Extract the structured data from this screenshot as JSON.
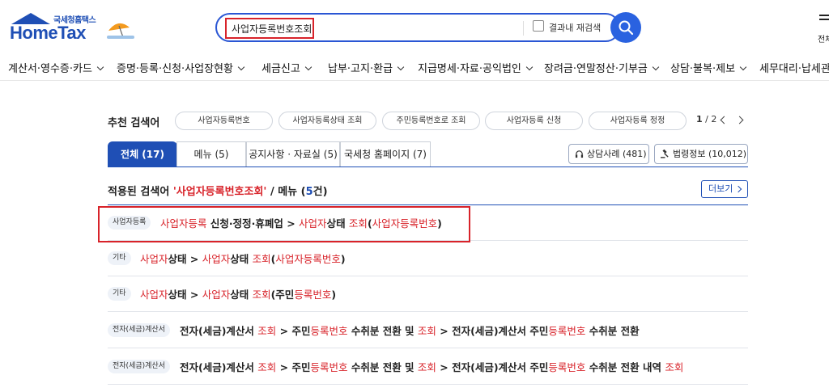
{
  "header": {
    "logo_small": "국세청홈택스",
    "logo_main": "HomeTax",
    "search_value": "사업자등록번호조회",
    "recheck_label": "결과내 재검색",
    "all_menu_label": "전체"
  },
  "nav": [
    "계산서·영수증·카드",
    "증명·등록·신청·사업장현황",
    "세금신고",
    "납부·고지·환급",
    "지급명세·자료·공익법인",
    "장려금·연말정산·기부금",
    "상담·불복·제보",
    "세무대리·납세관리"
  ],
  "recommend": {
    "label": "추천 검색어",
    "chips": [
      "사업자등록번호",
      "사업자등록상태 조회",
      "주민등록번호로 조회",
      "사업자등록 신청",
      "사업자등록 정정"
    ],
    "page_current": "1",
    "page_sep": " / ",
    "page_total": "2"
  },
  "tabs": [
    "전체 (17)",
    "메뉴 (5)",
    "공지사항 · 자료실 (5)",
    "국세청 홈페이지 (7)"
  ],
  "side_buttons": [
    "상담사례 (481)",
    "법령정보 (10,012)"
  ],
  "applied": {
    "prefix": "적용된 검색어 ",
    "keyword": "'사업자등록번호조회'",
    "mid": " / 메뉴 (",
    "count": "5",
    "suffix": "건)"
  },
  "more_label": "더보기",
  "results": [
    {
      "badge": "사업자등록",
      "parts": [
        [
          "사업자등록",
          true
        ],
        [
          " 신청·정정·휴폐업 > ",
          false
        ],
        [
          "사업자",
          true
        ],
        [
          "상태 ",
          false
        ],
        [
          "조회",
          true
        ],
        [
          "(",
          false
        ],
        [
          "사업자등록번호",
          true
        ],
        [
          ")",
          false
        ]
      ]
    },
    {
      "badge": "기타",
      "parts": [
        [
          "사업자",
          true
        ],
        [
          "상태 > ",
          false
        ],
        [
          "사업자",
          true
        ],
        [
          "상태 ",
          false
        ],
        [
          "조회",
          true
        ],
        [
          "(",
          false
        ],
        [
          "사업자등록번호",
          true
        ],
        [
          ")",
          false
        ]
      ]
    },
    {
      "badge": "기타",
      "parts": [
        [
          "사업자",
          true
        ],
        [
          "상태 > ",
          false
        ],
        [
          "사업자",
          true
        ],
        [
          "상태 ",
          false
        ],
        [
          "조회",
          true
        ],
        [
          "(주민",
          false
        ],
        [
          "등록번호",
          true
        ],
        [
          ")",
          false
        ]
      ]
    },
    {
      "badge": "전자(세금)계산서",
      "parts": [
        [
          "전자(세금)계산서 ",
          false
        ],
        [
          "조회",
          true
        ],
        [
          " > 주민",
          false
        ],
        [
          "등록번호",
          true
        ],
        [
          " 수취분 전환 및 ",
          false
        ],
        [
          "조회",
          true
        ],
        [
          " > 전자(세금)계산서 주민",
          false
        ],
        [
          "등록번호",
          true
        ],
        [
          " 수취분 전환",
          false
        ]
      ]
    },
    {
      "badge": "전자(세금)계산서",
      "parts": [
        [
          "전자(세금)계산서 ",
          false
        ],
        [
          "조회",
          true
        ],
        [
          " > 주민",
          false
        ],
        [
          "등록번호",
          true
        ],
        [
          " 수취분 전환 및 ",
          false
        ],
        [
          "조회",
          true
        ],
        [
          " > 전자(세금)계산서 주민",
          false
        ],
        [
          "등록번호",
          true
        ],
        [
          " 수취분 전환 내역 ",
          false
        ],
        [
          "조회",
          true
        ]
      ]
    }
  ],
  "colors": {
    "brand_blue": "#1f4fb5",
    "search_blue": "#2a62e0",
    "highlight_red": "#d8232a"
  }
}
